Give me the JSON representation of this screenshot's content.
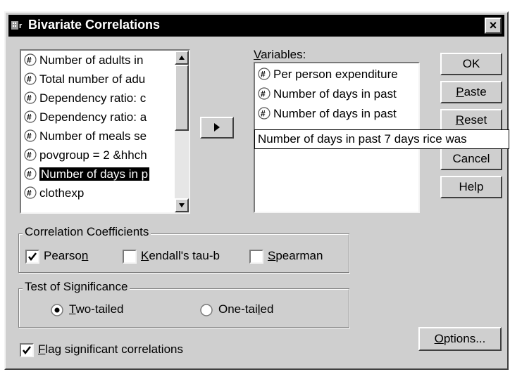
{
  "window": {
    "title": "Bivariate Correlations",
    "close_label": "×"
  },
  "source_list": {
    "items": [
      {
        "label": "Number of adults in",
        "selected": false
      },
      {
        "label": "Total number of adu",
        "selected": false
      },
      {
        "label": "Dependency ratio: c",
        "selected": false
      },
      {
        "label": "Dependency ratio: a",
        "selected": false
      },
      {
        "label": "Number of meals se",
        "selected": false
      },
      {
        "label": "povgroup = 2 &hhch",
        "selected": false
      },
      {
        "label": "Number of days in p",
        "selected": true
      },
      {
        "label": "clothexp",
        "selected": false
      }
    ]
  },
  "move_button": {
    "icon": "arrow-right-icon"
  },
  "variables": {
    "label": "Variables:",
    "items": [
      {
        "label": "Per person expenditure"
      },
      {
        "label": "Number of days in past"
      },
      {
        "label": "Number of days in past"
      }
    ],
    "tooltip": "Number of days in past 7 days rice was"
  },
  "buttons": {
    "ok": "OK",
    "paste": "Paste",
    "reset": "Reset",
    "cancel": "Cancel",
    "help": "Help",
    "options": "Options..."
  },
  "coefficients": {
    "title": "Correlation Coefficients",
    "pearson": {
      "label": "Pearson",
      "checked": true
    },
    "kendall": {
      "label": "Kendall's tau-b",
      "checked": false
    },
    "spearman": {
      "label": "Spearman",
      "checked": false
    }
  },
  "significance": {
    "title": "Test of Significance",
    "two_tailed": {
      "label": "Two-tailed",
      "selected": true
    },
    "one_tailed": {
      "label": "One-tailed",
      "selected": false
    }
  },
  "flag": {
    "label": "Flag significant correlations",
    "checked": true
  }
}
